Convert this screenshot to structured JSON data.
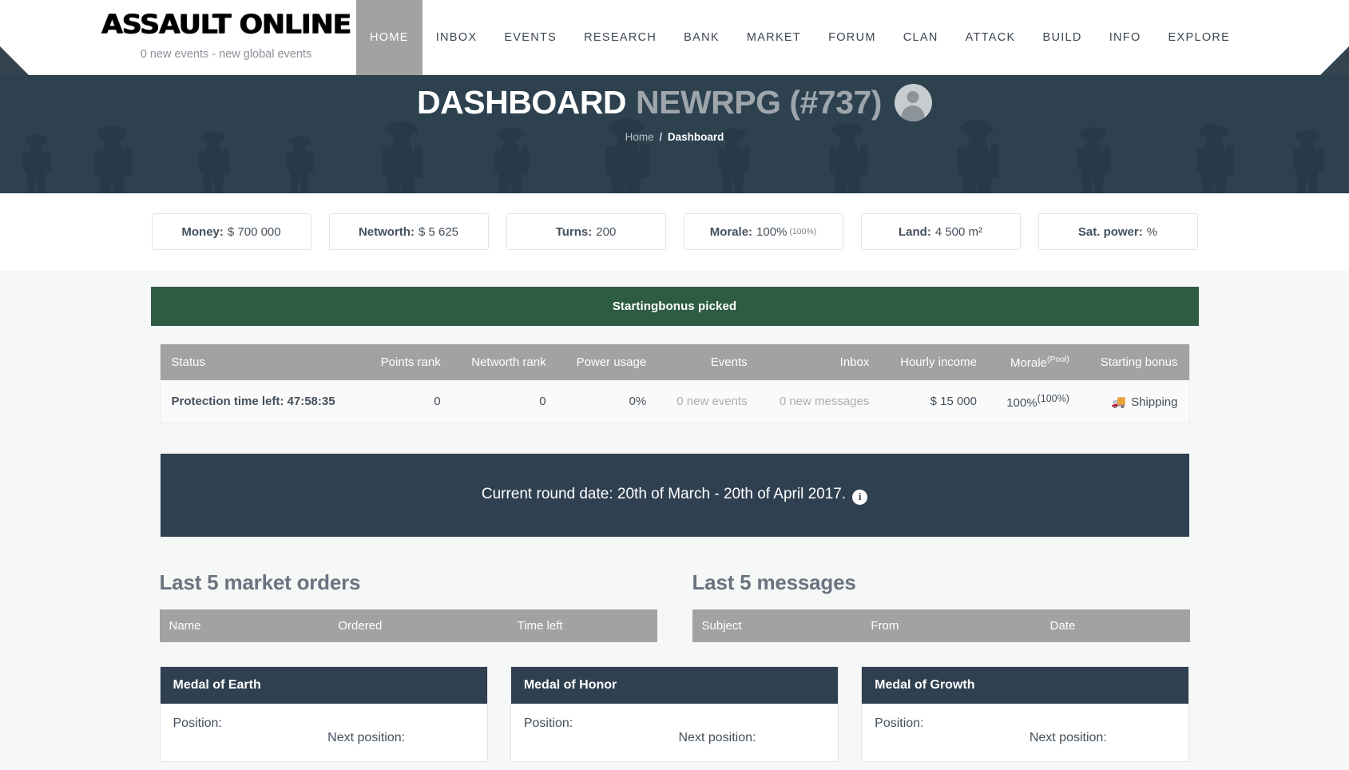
{
  "brand": {
    "logo_text": "ASSAULT ONLINE",
    "subtitle": "0 new events - new global events"
  },
  "nav": {
    "items": [
      {
        "label": "HOME",
        "active": true
      },
      {
        "label": "INBOX",
        "active": false
      },
      {
        "label": "EVENTS",
        "active": false
      },
      {
        "label": "RESEARCH",
        "active": false
      },
      {
        "label": "BANK",
        "active": false
      },
      {
        "label": "MARKET",
        "active": false
      },
      {
        "label": "FORUM",
        "active": false
      },
      {
        "label": "CLAN",
        "active": false
      },
      {
        "label": "ATTACK",
        "active": false
      },
      {
        "label": "BUILD",
        "active": false
      },
      {
        "label": "INFO",
        "active": false
      },
      {
        "label": "EXPLORE",
        "active": false
      }
    ]
  },
  "hero": {
    "title_main": "DASHBOARD",
    "title_sub": "NEWRPG (#737)",
    "breadcrumb_home": "Home",
    "breadcrumb_sep": "/",
    "breadcrumb_current": "Dashboard"
  },
  "stats": [
    {
      "label": "Money:",
      "value": "$ 700 000",
      "sup": ""
    },
    {
      "label": "Networth:",
      "value": "$ 5 625",
      "sup": ""
    },
    {
      "label": "Turns:",
      "value": "200",
      "sup": ""
    },
    {
      "label": "Morale:",
      "value": "100%",
      "sup": "(100%)"
    },
    {
      "label": "Land:",
      "value": "4 500 m²",
      "sup": ""
    },
    {
      "label": "Sat. power:",
      "value": "%",
      "sup": ""
    }
  ],
  "alert": {
    "text": "Startingbonus picked",
    "color": "#2e5c43"
  },
  "status_table": {
    "headers": [
      "Status",
      "Points rank",
      "Networth rank",
      "Power usage",
      "Events",
      "Inbox",
      "Hourly income",
      "Morale",
      "Starting bonus"
    ],
    "morale_sup": "(Pool)",
    "row": {
      "status": "Protection time left: 47:58:35",
      "points_rank": "0",
      "networth_rank": "0",
      "power_usage": "0%",
      "events": "0 new events",
      "inbox": "0 new messages",
      "hourly_income": "$ 15 000",
      "morale": "100%",
      "morale_pool": "(100%)",
      "starting_bonus": "Shipping",
      "starting_bonus_icon": "truck-icon"
    }
  },
  "round_banner": {
    "text": "Current round date: 20th of March - 20th of April 2017.",
    "info_icon": "info-circle-icon",
    "info_glyph": "i"
  },
  "market_orders": {
    "heading": "Last 5 market orders",
    "headers": [
      "Name",
      "Ordered",
      "Time left"
    ],
    "rows": []
  },
  "messages": {
    "heading": "Last 5 messages",
    "headers": [
      "Subject",
      "From",
      "Date"
    ],
    "rows": []
  },
  "medals": [
    {
      "title": "Medal of Earth",
      "position_label": "Position:",
      "next_label": "Next position:"
    },
    {
      "title": "Medal of Honor",
      "position_label": "Position:",
      "next_label": "Next position:"
    },
    {
      "title": "Medal of Growth",
      "position_label": "Position:",
      "next_label": "Next position:"
    }
  ],
  "colors": {
    "nav_dark": "#2f4050",
    "nav_active": "#a2a2a2",
    "success": "#2e5c43",
    "table_header": "#a2a2a2",
    "page_bg": "#f6f7f7"
  }
}
